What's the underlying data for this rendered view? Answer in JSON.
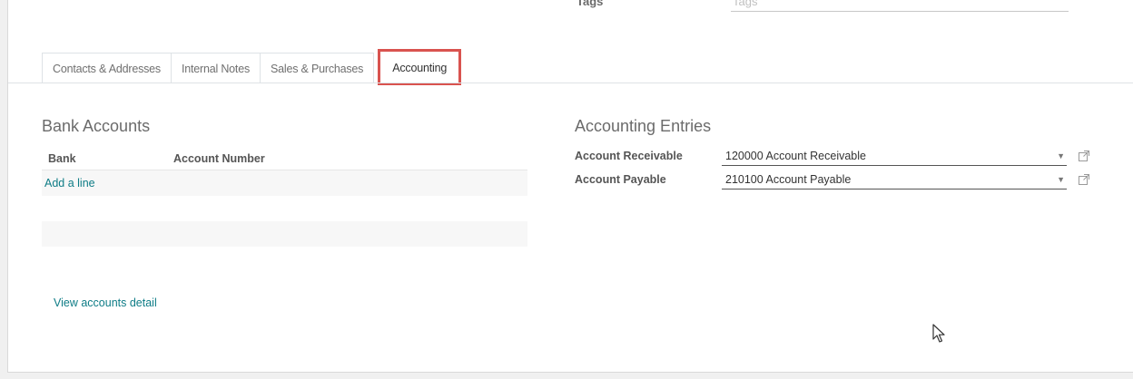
{
  "top_field": {
    "label": "Tags",
    "placeholder": "Tags"
  },
  "tabs": [
    {
      "label": "Contacts & Addresses",
      "active": false
    },
    {
      "label": "Internal Notes",
      "active": false
    },
    {
      "label": "Sales & Purchases",
      "active": false
    },
    {
      "label": "Accounting",
      "active": true
    }
  ],
  "bank_accounts": {
    "title": "Bank Accounts",
    "columns": [
      "Bank",
      "Account Number"
    ],
    "add_line": "Add a line",
    "view_detail": "View accounts detail"
  },
  "accounting_entries": {
    "title": "Accounting Entries",
    "fields": [
      {
        "label": "Account Receivable",
        "value": "120000 Account Receivable"
      },
      {
        "label": "Account Payable",
        "value": "210100 Account Payable"
      }
    ]
  },
  "colors": {
    "accent_link": "#0e7c86",
    "highlight_box": "#d9534f"
  },
  "icons": {
    "dropdown": "caret-down-icon",
    "external": "external-link-icon",
    "cursor": "mouse-cursor-icon"
  }
}
